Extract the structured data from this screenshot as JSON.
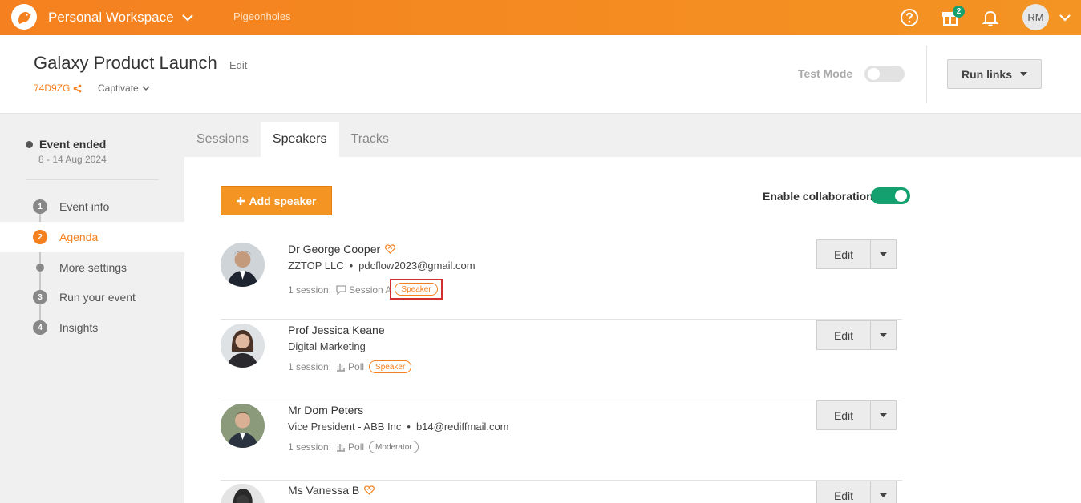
{
  "topbar": {
    "workspace": "Personal Workspace",
    "nav_link": "Pigeonholes",
    "gift_badge": "2",
    "user_initials": "RM"
  },
  "event": {
    "title": "Galaxy Product Launch",
    "edit_label": "Edit",
    "code": "74D9ZG",
    "product": "Captivate",
    "test_mode_label": "Test Mode",
    "run_links_label": "Run links"
  },
  "sidebar": {
    "status": "Event ended",
    "dates": "8 - 14 Aug 2024",
    "steps": [
      {
        "num": "1",
        "label": "Event info"
      },
      {
        "num": "2",
        "label": "Agenda"
      },
      {
        "num": "",
        "label": "More settings"
      },
      {
        "num": "3",
        "label": "Run your event"
      },
      {
        "num": "4",
        "label": "Insights"
      }
    ]
  },
  "tabs": [
    "Sessions",
    "Speakers",
    "Tracks"
  ],
  "main": {
    "add_speaker_label": "Add speaker",
    "collaboration_label": "Enable collaboration",
    "edit_label": "Edit",
    "speakers": [
      {
        "name": "Dr George Cooper",
        "org": "ZZTOP LLC",
        "email": "pdcflow2023@gmail.com",
        "sessions_count": "1 session:",
        "session_name": "Session A",
        "role": "Speaker"
      },
      {
        "name": "Prof Jessica Keane",
        "org": "Digital Marketing",
        "email": "",
        "sessions_count": "1 session:",
        "session_name": "Poll",
        "role": "Speaker"
      },
      {
        "name": "Mr Dom Peters",
        "org": "Vice President - ABB Inc",
        "email": "b14@rediffmail.com",
        "sessions_count": "1 session:",
        "session_name": "Poll",
        "role": "Moderator"
      },
      {
        "name": "Ms Vanessa B"
      }
    ]
  }
}
